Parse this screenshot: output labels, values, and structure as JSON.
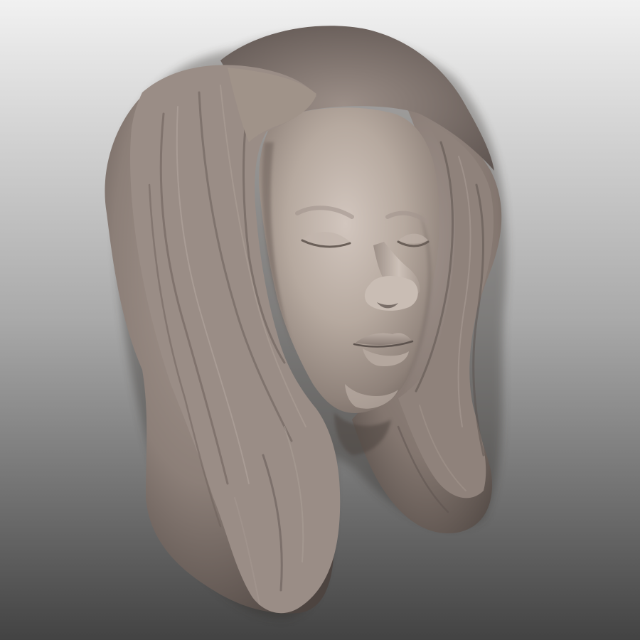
{
  "scene": {
    "subject": "sculpted-female-head-with-long-hair",
    "material": "clay-matcap",
    "background_gradient": {
      "top": "#f1f1f1",
      "middle": "#a9a9a9",
      "bottom": "#434343"
    },
    "clay_colors": {
      "highlight": "#c9bcb4",
      "base": "#978a82",
      "shadow": "#594f4a",
      "deep_shadow": "#352f2c"
    },
    "eyes": "closed",
    "view": "three-quarter-right"
  }
}
